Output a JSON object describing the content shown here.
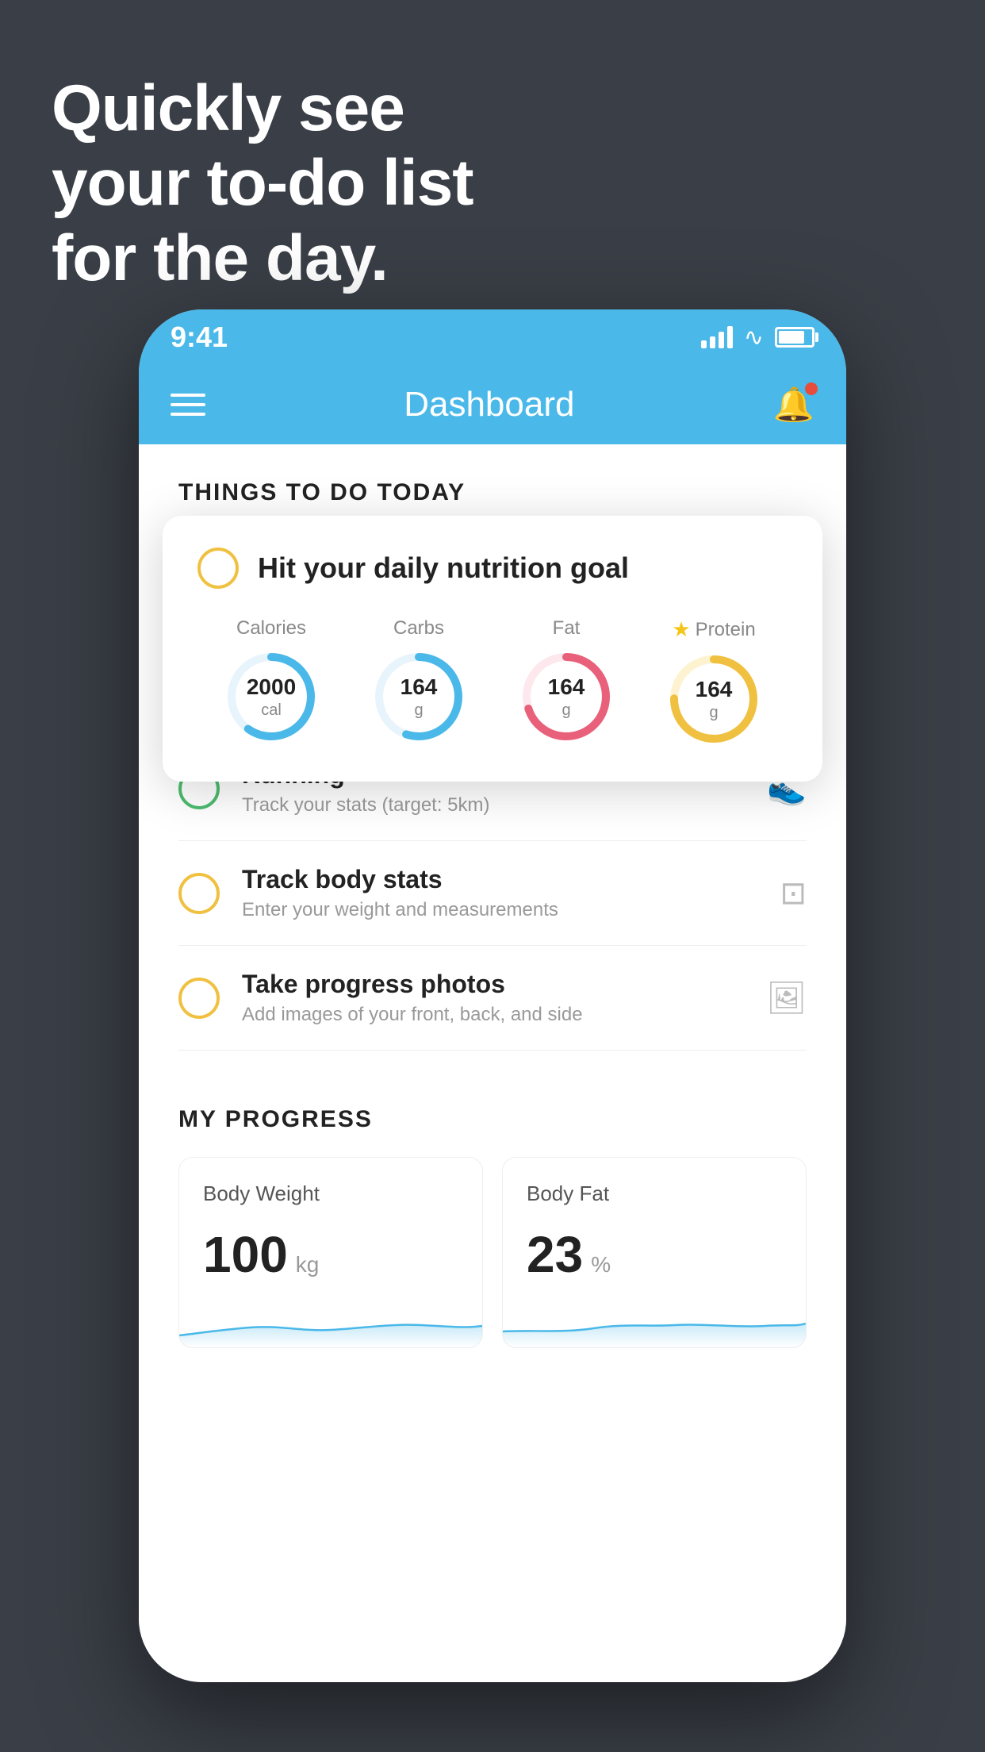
{
  "background": {
    "color": "#3a3f47"
  },
  "headline": {
    "line1": "Quickly see",
    "line2": "your to-do list",
    "line3": "for the day."
  },
  "phone": {
    "status_bar": {
      "time": "9:41"
    },
    "header": {
      "title": "Dashboard",
      "menu_label": "menu",
      "bell_label": "notifications"
    },
    "section_title": "THINGS TO DO TODAY",
    "floating_card": {
      "title": "Hit your daily nutrition goal",
      "nutrition": [
        {
          "label": "Calories",
          "value": "2000",
          "unit": "cal",
          "color": "#4ab8e8",
          "percent": 60,
          "star": false
        },
        {
          "label": "Carbs",
          "value": "164",
          "unit": "g",
          "color": "#4ab8e8",
          "percent": 55,
          "star": false
        },
        {
          "label": "Fat",
          "value": "164",
          "unit": "g",
          "color": "#e8607a",
          "percent": 70,
          "star": false
        },
        {
          "label": "Protein",
          "value": "164",
          "unit": "g",
          "color": "#f0c040",
          "percent": 75,
          "star": true
        }
      ]
    },
    "todo_items": [
      {
        "title": "Running",
        "subtitle": "Track your stats (target: 5km)",
        "icon": "shoe",
        "checkbox_color": "green"
      },
      {
        "title": "Track body stats",
        "subtitle": "Enter your weight and measurements",
        "icon": "scale",
        "checkbox_color": "yellow"
      },
      {
        "title": "Take progress photos",
        "subtitle": "Add images of your front, back, and side",
        "icon": "photo",
        "checkbox_color": "yellow"
      }
    ],
    "progress_section": {
      "title": "MY PROGRESS",
      "cards": [
        {
          "title": "Body Weight",
          "value": "100",
          "unit": "kg"
        },
        {
          "title": "Body Fat",
          "value": "23",
          "unit": "%"
        }
      ]
    }
  }
}
